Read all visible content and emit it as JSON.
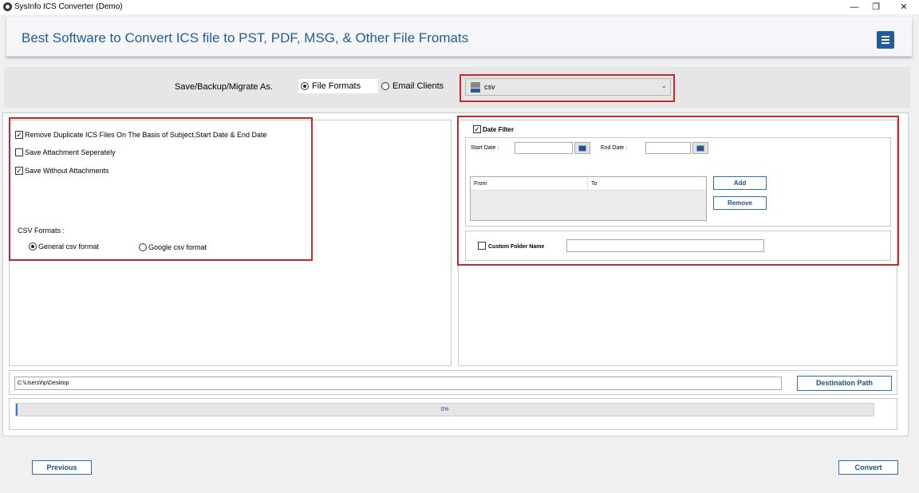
{
  "window": {
    "title": "SysInfo ICS Converter (Demo)",
    "minimize": "—",
    "restore": "❐",
    "close": "✕"
  },
  "header": {
    "title": "Best Software to Convert ICS file to PST, PDF, MSG, & Other File Fromats"
  },
  "save_as": {
    "label": "Save/Backup/Migrate As.",
    "options": [
      "File Formats",
      "Email Clients"
    ],
    "selected": "File Formats",
    "format_value": "csv",
    "format_icon": "csv-file-icon"
  },
  "options": {
    "remove_duplicates": {
      "label": "Remove Duplicate ICS Files On The Basis of Subject,Start Date & End Date",
      "checked": true
    },
    "save_attachment_separately": {
      "label": "Save Attachment Seperately",
      "checked": false
    },
    "save_without_attachments": {
      "label": "Save Without Attachments",
      "checked": true
    },
    "csv_formats_label": "CSV Formats :",
    "csv_formats": [
      "General csv format",
      "Google csv format"
    ],
    "csv_selected": "General csv format"
  },
  "date_filter": {
    "label": "Date Filter",
    "checked": true,
    "start_label": "Start Date :",
    "end_label": "End Date :",
    "start_value": "",
    "end_value": "",
    "columns": [
      "From",
      "To"
    ],
    "add_label": "Add",
    "remove_label": "Remove"
  },
  "custom_folder": {
    "label": "Custom Folder Name",
    "checked": false,
    "value": ""
  },
  "destination": {
    "path": "C:\\Users\\hp\\Desktop",
    "button_label": "Destination Path"
  },
  "progress": {
    "percent": 0,
    "label": "0%"
  },
  "footer": {
    "previous_label": "Previous",
    "convert_label": "Convert"
  },
  "colors": {
    "accent": "#1f5c99",
    "highlight_border": "#d1232a"
  }
}
